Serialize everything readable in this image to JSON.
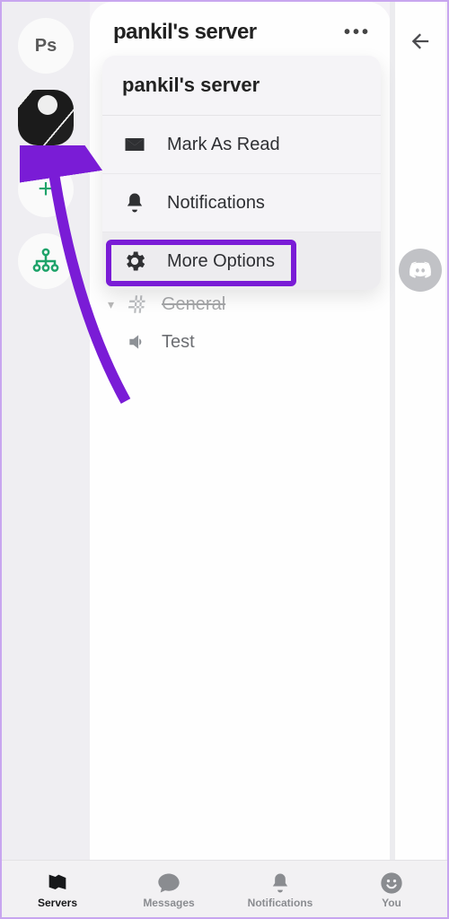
{
  "rail": {
    "initials": "Ps"
  },
  "panel": {
    "title": "pankil's server"
  },
  "channels": {
    "general": "General",
    "test": "Test"
  },
  "popup": {
    "title": "pankil's server",
    "mark_read": "Mark As Read",
    "notifications": "Notifications",
    "more_options": "More Options"
  },
  "tabs": {
    "servers": "Servers",
    "messages": "Messages",
    "notifications": "Notifications",
    "you": "You"
  }
}
